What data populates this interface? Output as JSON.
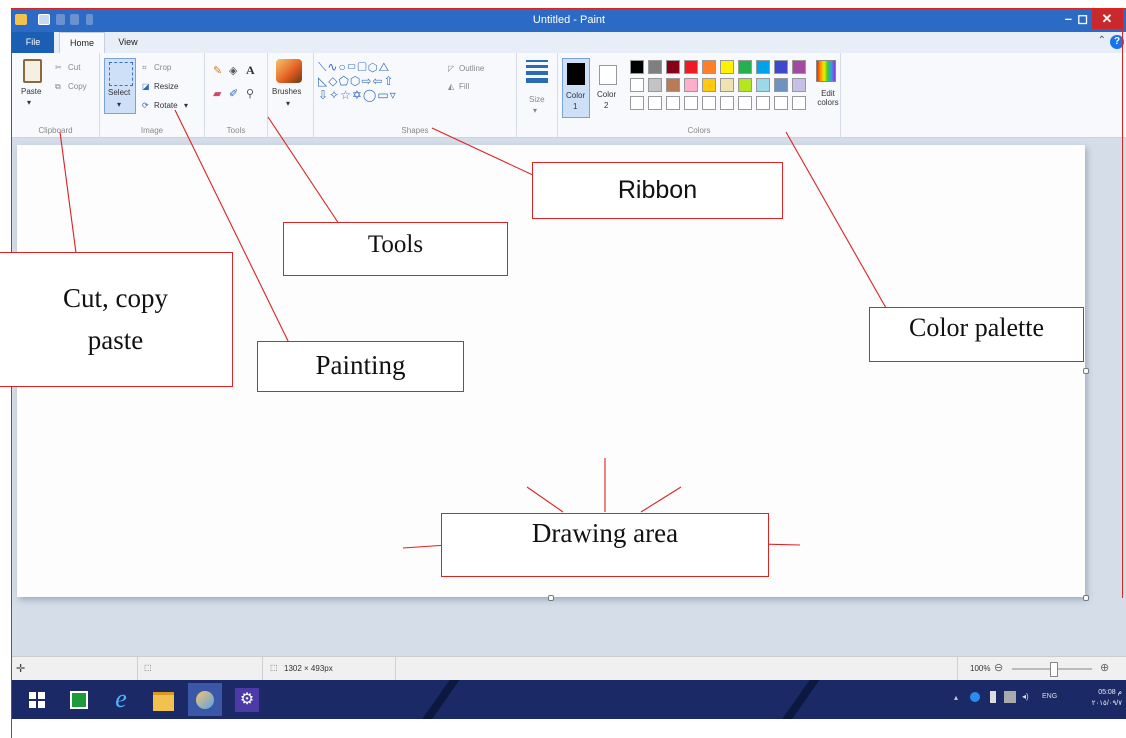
{
  "window": {
    "title": "Untitled - Paint",
    "minimize_glyph": "–",
    "maximize_glyph": "◻",
    "close_glyph": "✕"
  },
  "tabs": [
    {
      "label": "File"
    },
    {
      "label": "Home"
    },
    {
      "label": "View"
    }
  ],
  "ribbon": {
    "clipboard": {
      "paste": "Paste",
      "cut": "Cut",
      "copy": "Copy",
      "group": "Clipboard"
    },
    "image": {
      "select": "Select",
      "crop": "Crop",
      "resize": "Resize",
      "rotate": "Rotate",
      "group": "Image"
    },
    "tools": {
      "group": "Tools",
      "text_tool": "A"
    },
    "brushes": {
      "label": "Brushes"
    },
    "shapes": {
      "outline": "Outline",
      "fill": "Fill",
      "group": "Shapes"
    },
    "size": {
      "label": "Size"
    },
    "color1": {
      "label": "Color",
      "index": "1"
    },
    "color2": {
      "label": "Color",
      "index": "2"
    },
    "colors_group": "Colors",
    "edit_colors": "Edit colors"
  },
  "palette": {
    "row1": [
      "#000000",
      "#7f7f7f",
      "#880015",
      "#ed1c24",
      "#ff7f27",
      "#fff200",
      "#22b14c",
      "#00a2e8",
      "#3f48cc",
      "#a349a4"
    ],
    "row2": [
      "#ffffff",
      "#c3c3c3",
      "#b97a57",
      "#ffaec9",
      "#ffc90e",
      "#efe4b0",
      "#b5e61d",
      "#99d9ea",
      "#7092be",
      "#c8bfe7"
    ],
    "row3": [
      "#ffffff",
      "#ffffff",
      "#ffffff",
      "#ffffff",
      "#ffffff",
      "#ffffff",
      "#ffffff",
      "#ffffff",
      "#ffffff",
      "#ffffff"
    ]
  },
  "status": {
    "canvas_size": "1302 × 493px",
    "zoom": "100%"
  },
  "tray": {
    "lang": "ENG",
    "time": "05:08 م",
    "date": "٢٠١٥/٠٩/٧"
  },
  "annotations": {
    "ribbon": "Ribbon",
    "tools": "Tools",
    "cut_copy_paste_line1": "Cut, copy",
    "cut_copy_paste_line2": "paste",
    "painting": "Painting",
    "color_palette": "Color palette",
    "drawing_area": "Drawing area"
  },
  "colors": {
    "titlebar": "#2b6bc6",
    "annotation": "#dd2222",
    "taskbar": "#1b2a66"
  }
}
